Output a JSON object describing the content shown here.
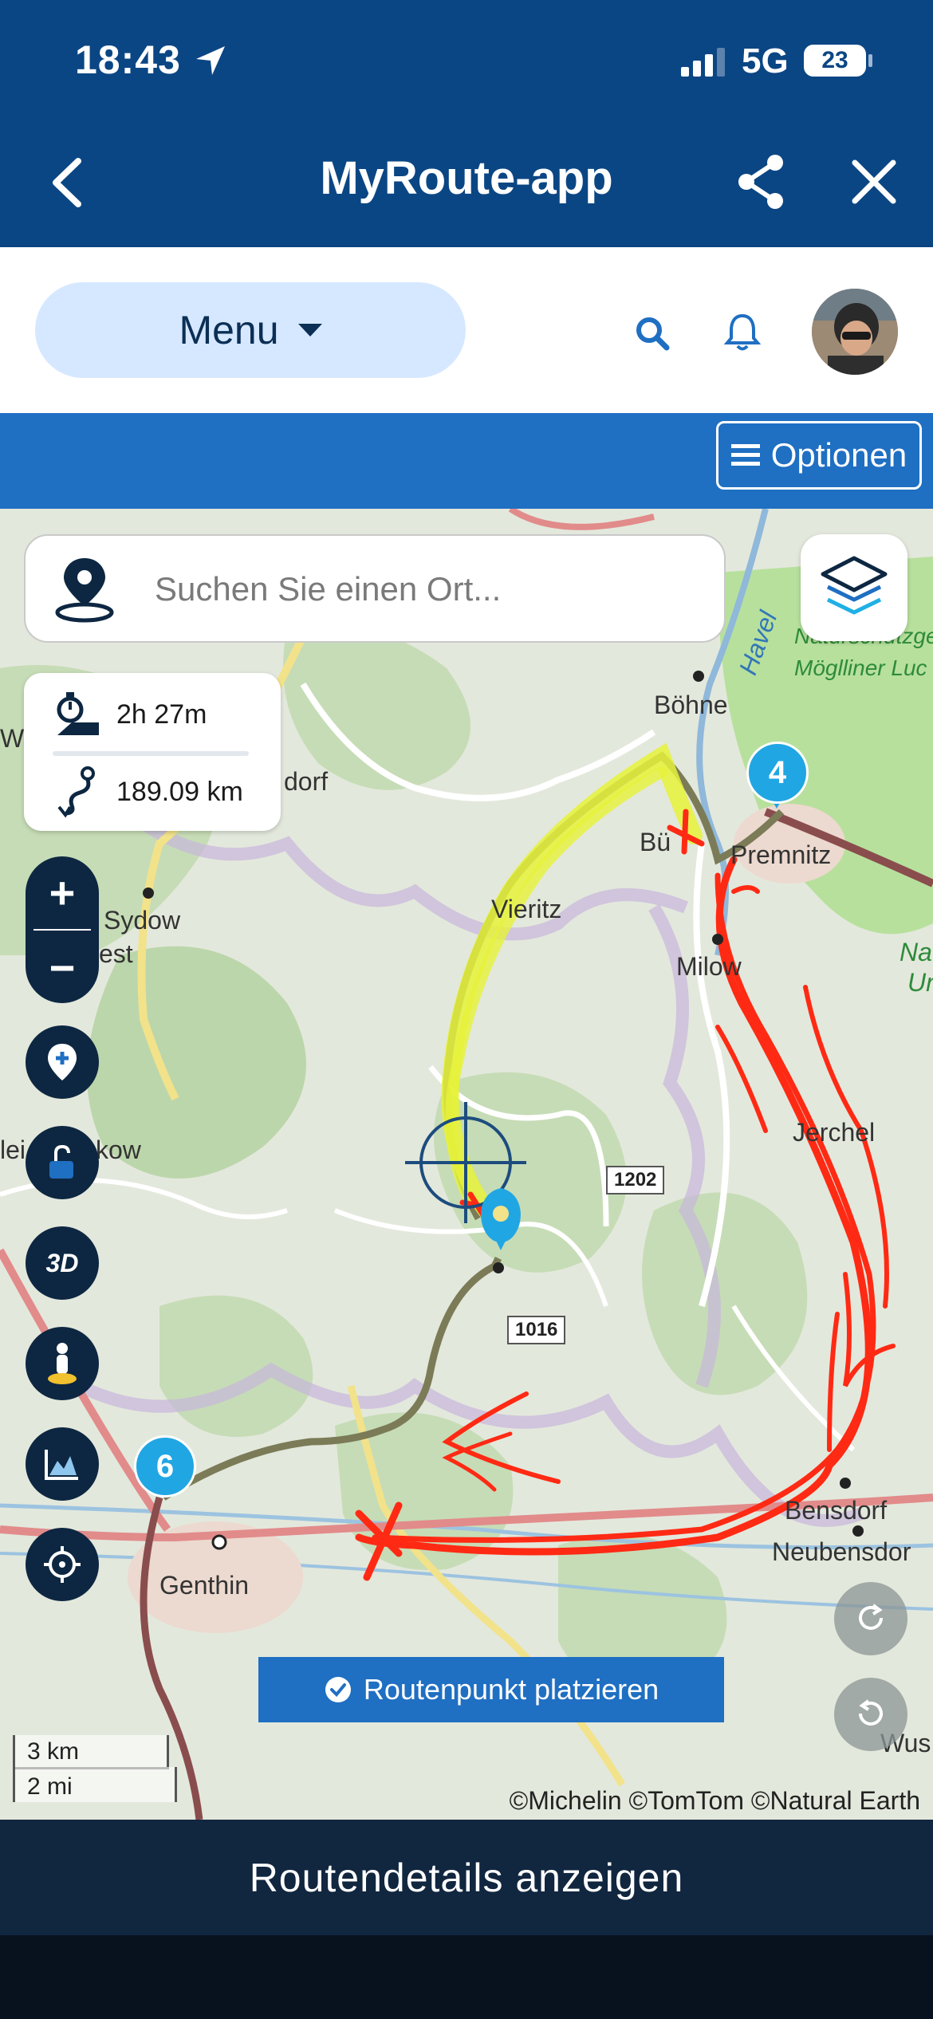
{
  "status": {
    "time": "18:43",
    "network": "5G",
    "battery": "23"
  },
  "header": {
    "title": "MyRoute-app"
  },
  "menubar": {
    "menu_label": "Menu"
  },
  "options": {
    "label": "Optionen"
  },
  "search": {
    "placeholder": "Suchen Sie einen Ort..."
  },
  "route_info": {
    "duration": "2h 27m",
    "distance": "189.09 km"
  },
  "map": {
    "labels": [
      "Böhne",
      "Havel",
      "Naturschutzgeb",
      "Möglliner Luc",
      "Wu",
      "dorf",
      "Sydow",
      "est",
      "Vieritz",
      "Premnitz",
      "Bü",
      "Milow",
      "Nat",
      "Un",
      "Jerchel",
      "lei",
      "kow",
      "Bensdorf",
      "Neubensdor",
      "Genthin",
      "Wus"
    ],
    "roads": [
      "1202",
      "1016"
    ],
    "waypoints": [
      "4",
      "6"
    ],
    "colors": {
      "route": "#7b7b57",
      "highlight": "#e6f23a",
      "annotation": "#ff2a14"
    }
  },
  "place_button": {
    "label": "Routenpunkt platzieren"
  },
  "scale": {
    "km": "3 km",
    "mi": "2 mi"
  },
  "attribution": "©Michelin ©TomTom ©Natural Earth",
  "bottom": {
    "label": "Routendetails anzeigen"
  },
  "tools": [
    "3D"
  ]
}
